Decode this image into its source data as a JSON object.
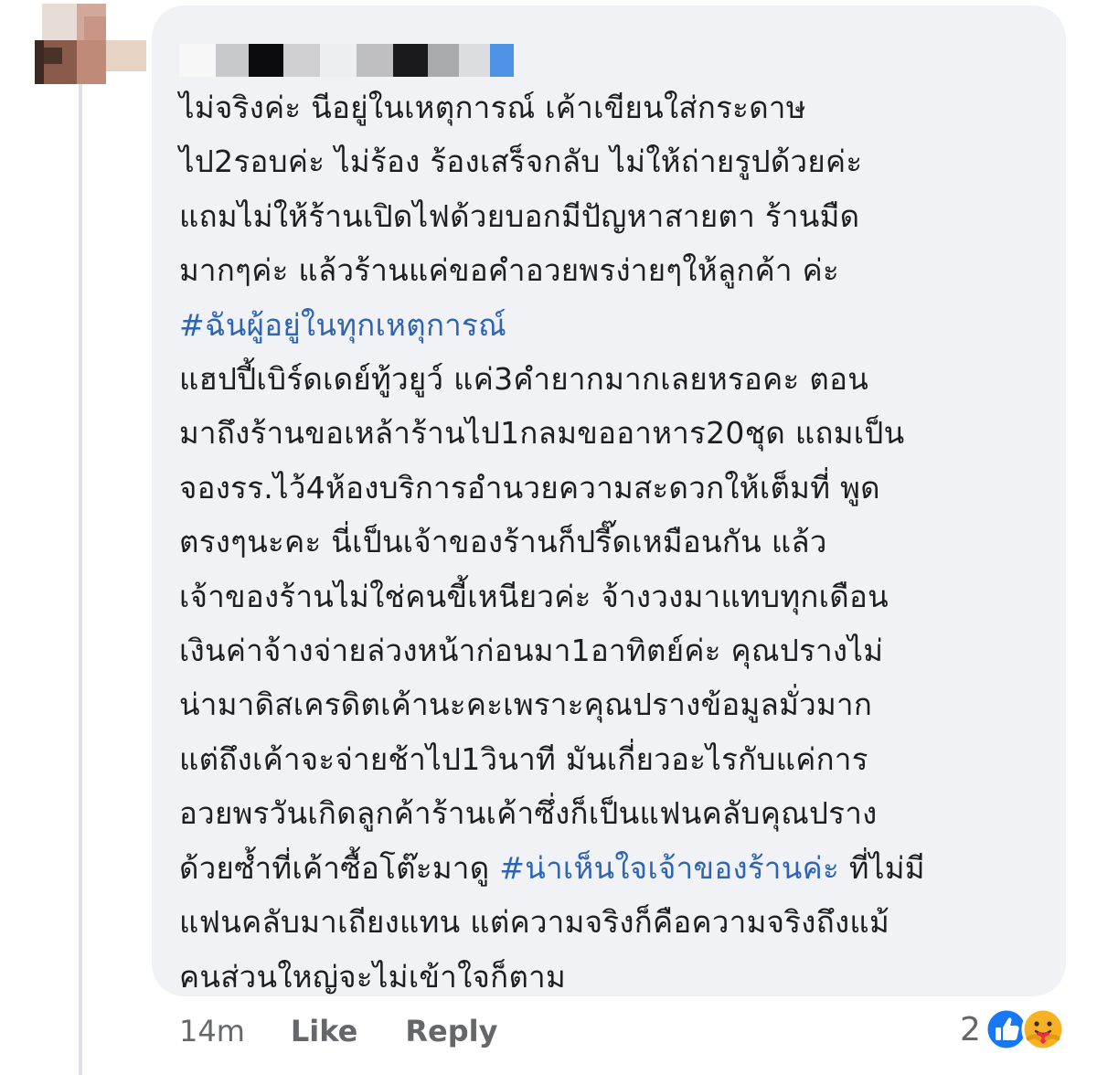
{
  "comment": {
    "author_name": "",
    "lines": [
      {
        "text": "ไม่จริงค่ะ นีอยู่ในเหตุการณ์ เค้าเขียนใส่กระดาษ",
        "hashtag": false
      },
      {
        "text": "ไป2รอบค่ะ ไม่ร้อง ร้องเสร็จกลับ ไม่ให้ถ่ายรูปด้วยค่ะ",
        "hashtag": false
      },
      {
        "text": "แถมไม่ให้ร้านเปิดไฟด้วยบอกมีปัญหาสายตา ร้านมืด",
        "hashtag": false
      },
      {
        "text": "มากๆค่ะ แล้วร้านแค่ขอคำอวยพรง่ายๆให้ลูกค้า ค่ะ",
        "hashtag": false
      },
      {
        "text": "#ฉันผู้อยู่ในทุกเหตุการณ์",
        "hashtag": true
      },
      {
        "text": "แฮปปี้เบิร์ดเดย์ทู้วยูว์ แค่3คำยากมากเลยหรอคะ ตอน",
        "hashtag": false
      },
      {
        "text": "มาถึงร้านขอเหล้าร้านไป1กลมขออาหาร20ชุด แถมเป็น",
        "hashtag": false
      },
      {
        "text": "จองรร.ไว้4ห้องบริการอำนวยความสะดวกให้เต็มที่ พูด",
        "hashtag": false
      },
      {
        "text": "ตรงๆนะคะ นี่เป็นเจ้าของร้านก็ปรี๊ดเหมือนกัน แล้ว",
        "hashtag": false
      },
      {
        "text": "เจ้าของร้านไม่ใช่คนขี้เหนียวค่ะ จ้างวงมาแทบทุกเดือน",
        "hashtag": false
      },
      {
        "text": "เงินค่าจ้างจ่ายล่วงหน้าก่อนมา1อาทิตย์ค่ะ คุณปรางไม่",
        "hashtag": false
      },
      {
        "text": "น่ามาดิสเครดิตเค้านะคะเพราะคุณปรางข้อมูลมั่วมาก",
        "hashtag": false
      },
      {
        "text": "แต่ถึงเค้าจะจ่ายช้าไป1วินาที มันเกี่ยวอะไรกับแค่การ",
        "hashtag": false
      },
      {
        "text": "อวยพรวันเกิดลูกค้าร้านเค้าซึ่งก็เป็นแฟนคลับคุณปราง",
        "hashtag": false
      }
    ],
    "line15": {
      "before": "ด้วยซ้ำที่เค้าซื้อโต๊ะมาดู ",
      "hashtag": "#น่าเห็นใจเจ้าของร้านค่ะ",
      "after": " ที่ไม่มี"
    },
    "lines_end": [
      "แฟนคลับมาเถียงแทน แต่ความจริงก็คือความจริงถึงแม้",
      "คนส่วนใหญ่จะไม่เข้าใจก็ตาม"
    ],
    "hashtag_color": "#2d64b4"
  },
  "actions": {
    "time": "14m",
    "like_label": "Like",
    "reply_label": "Reply"
  },
  "reactions": {
    "count": "2",
    "icons": [
      "like-icon",
      "care-icon"
    ],
    "like_color": "#1877f2",
    "care_color": "#f7b125"
  },
  "colors": {
    "bubble_bg": "#f0f2f5",
    "text": "#1c1e21",
    "meta_text": "#65676b"
  }
}
